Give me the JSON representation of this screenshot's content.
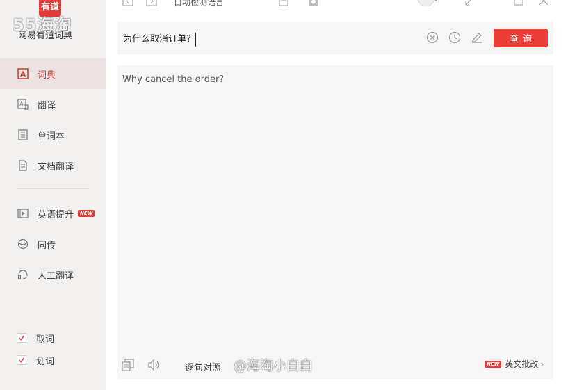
{
  "app": {
    "logo_text": "有道",
    "name": "网易有道词典"
  },
  "watermark": {
    "top": "55海淘",
    "bottom": "@海淘小白白"
  },
  "topbar": {
    "auto_read_label": "自动检测语言"
  },
  "sidebar": {
    "items": [
      {
        "label": "词典",
        "icon": "dictionary-icon",
        "active": true
      },
      {
        "label": "翻译",
        "icon": "translate-icon"
      },
      {
        "label": "单词本",
        "icon": "wordbook-icon"
      },
      {
        "label": "文档翻译",
        "icon": "document-icon"
      },
      {
        "label": "英语提升",
        "icon": "video-icon",
        "badge": "NEW"
      },
      {
        "label": "同传",
        "icon": "simultaneous-icon"
      },
      {
        "label": "人工翻译",
        "icon": "headset-icon"
      }
    ],
    "checks": [
      {
        "label": "取词",
        "checked": true
      },
      {
        "label": "划词",
        "checked": true
      }
    ]
  },
  "search": {
    "query": "为什么取消订单?",
    "button_label": "查询"
  },
  "result": {
    "text": "Why cancel the order?",
    "compare_label": "逐句对照",
    "essay_badge": "NEW",
    "essay_label": "英文批改"
  },
  "colors": {
    "accent": "#ed3d38",
    "sidebar_bg": "#f2f1f0",
    "panel_bg": "#f6f6f7"
  }
}
